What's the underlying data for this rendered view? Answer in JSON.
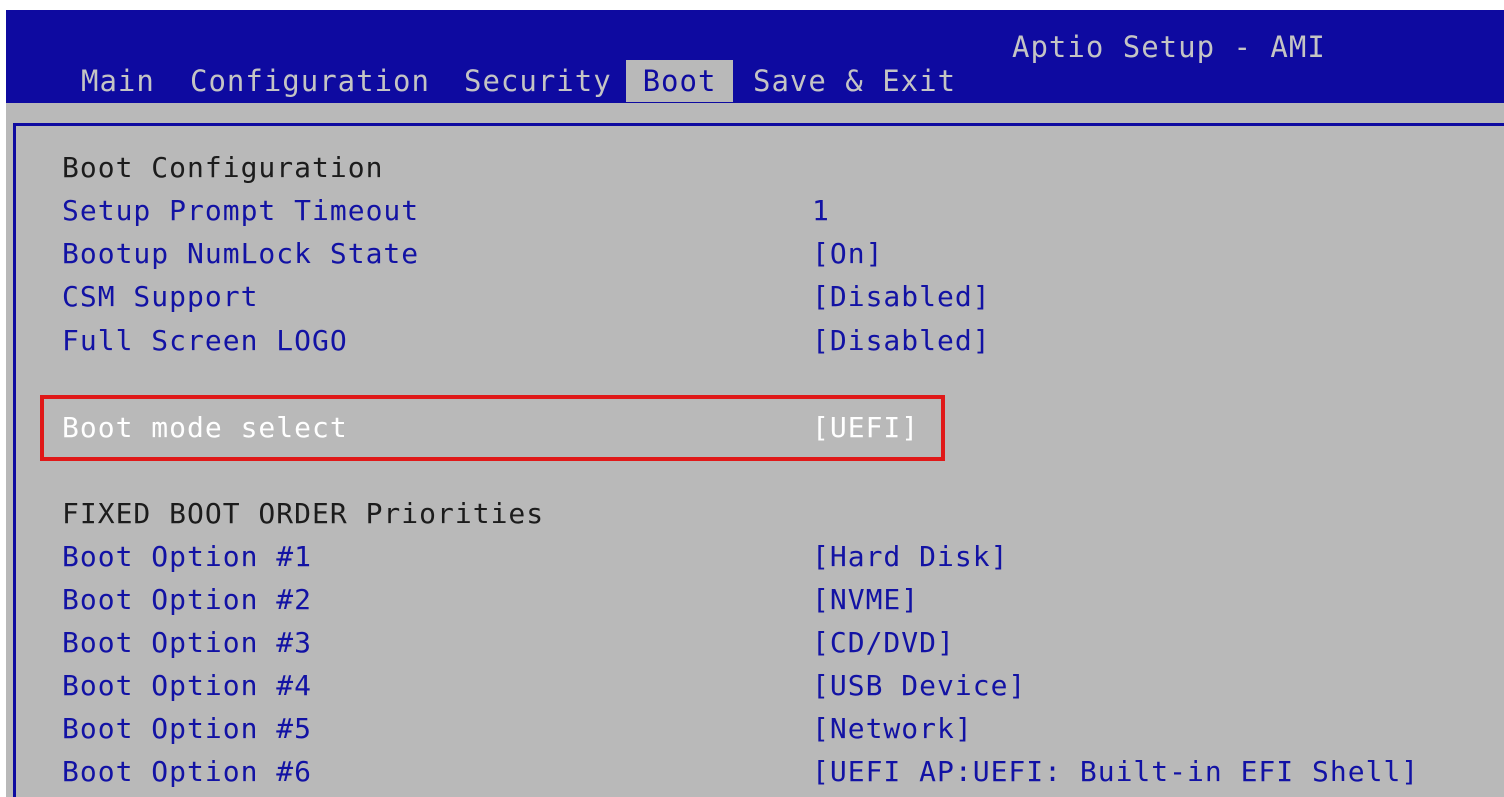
{
  "app": {
    "title": "Aptio Setup - AMI"
  },
  "tabs": [
    {
      "label": "Main",
      "active": false
    },
    {
      "label": "Configuration",
      "active": false
    },
    {
      "label": "Security",
      "active": false
    },
    {
      "label": "Boot",
      "active": true
    },
    {
      "label": "Save & Exit",
      "active": false
    }
  ],
  "boot": {
    "section_title": "Boot Configuration",
    "items": [
      {
        "label": "Setup Prompt Timeout",
        "value": "1"
      },
      {
        "label": "Bootup NumLock State",
        "value": "[On]"
      },
      {
        "label": "CSM Support",
        "value": "[Disabled]"
      },
      {
        "label": "Full Screen LOGO",
        "value": "[Disabled]"
      }
    ],
    "mode": {
      "label": "Boot mode select",
      "value": "[UEFI]",
      "highlighted": true
    },
    "priorities_title": "FIXED BOOT ORDER Priorities",
    "options": [
      {
        "label": "Boot Option #1",
        "value": "[Hard Disk]"
      },
      {
        "label": "Boot Option #2",
        "value": "[NVME]"
      },
      {
        "label": "Boot Option #3",
        "value": "[CD/DVD]"
      },
      {
        "label": "Boot Option #4",
        "value": "[USB Device]"
      },
      {
        "label": "Boot Option #5",
        "value": "[Network]"
      },
      {
        "label": "Boot Option #6",
        "value": "[UEFI AP:UEFI: Built-in EFI Shell]"
      }
    ]
  },
  "colors": {
    "header_bg": "#0e0aa0",
    "panel_bg": "#b9b9b9",
    "option_text": "#1212a4",
    "highlight_border": "#e01818"
  }
}
